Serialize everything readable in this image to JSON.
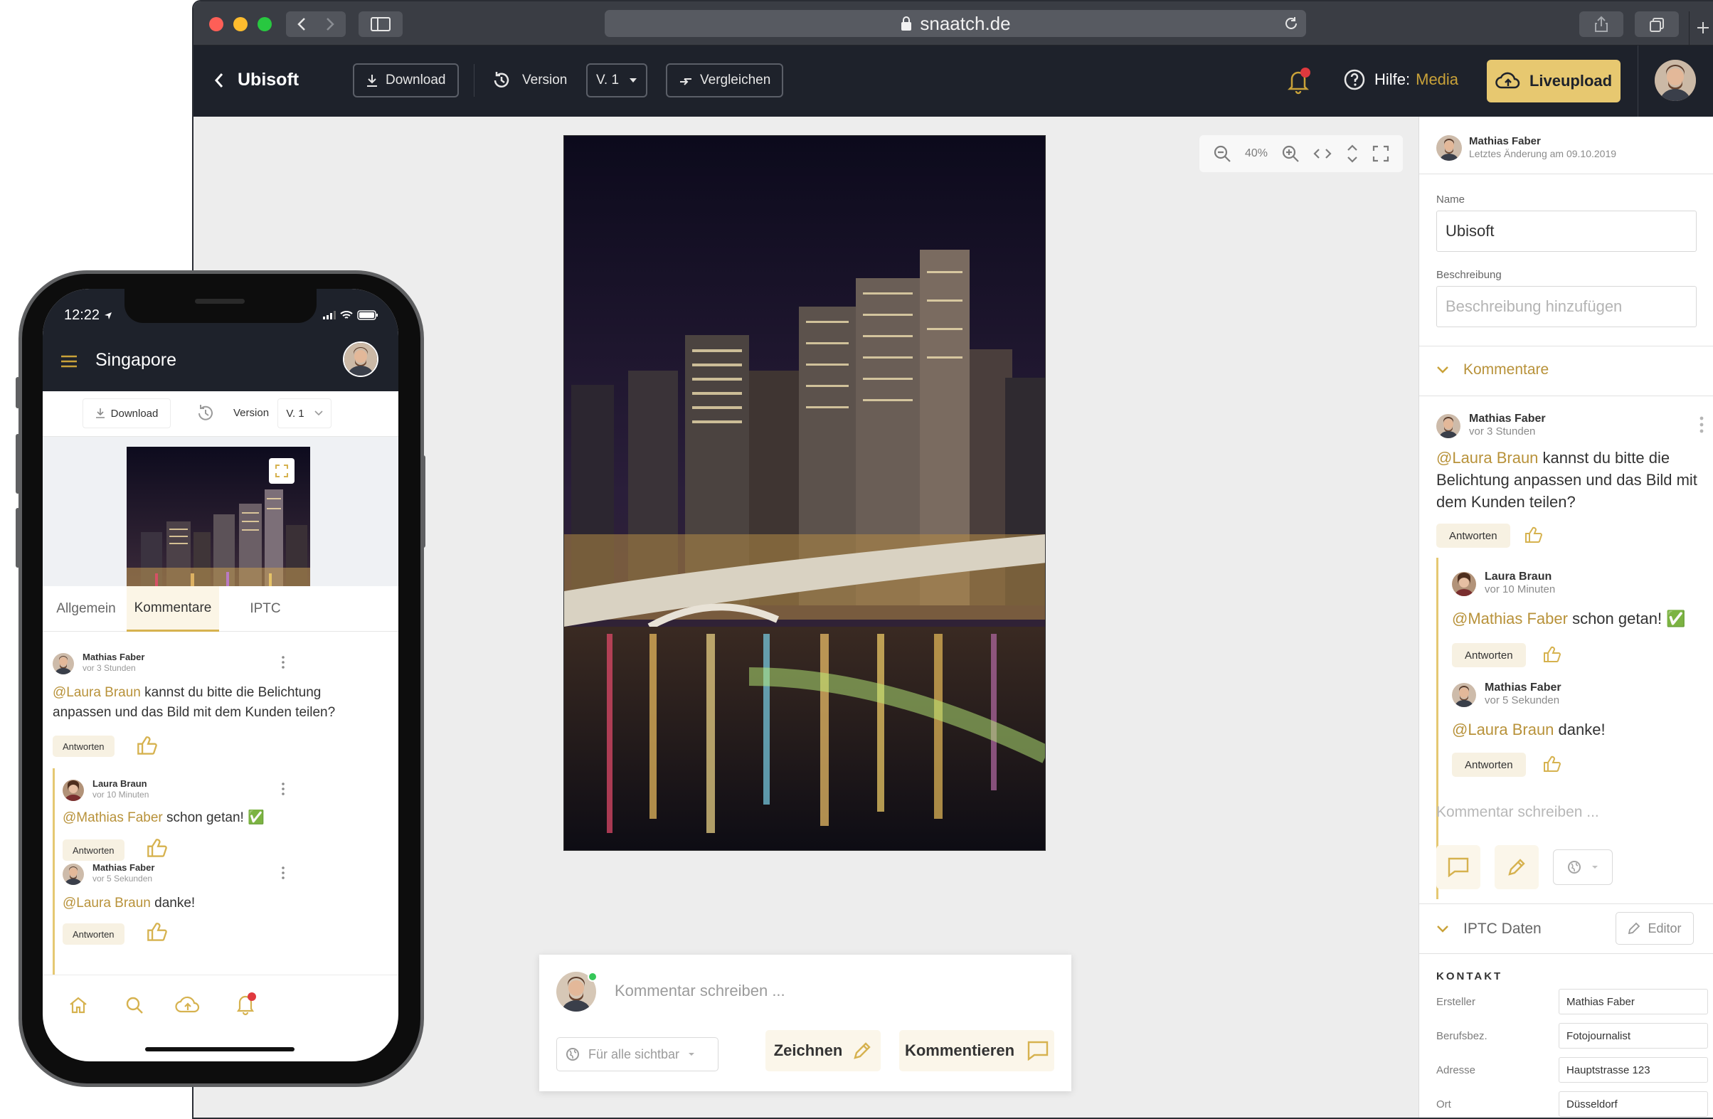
{
  "browser": {
    "url": "snaatch.de",
    "traffic_lights": [
      "#fe5f57",
      "#febc2e",
      "#28c840"
    ]
  },
  "appbar": {
    "back_title": "Ubisoft",
    "download_label": "Download",
    "version_label": "Version",
    "version_value": "V. 1",
    "compare_label": "Vergleichen",
    "help_label": "Hilfe:",
    "help_value": "Media",
    "liveupload_label": "Liveupload"
  },
  "viewer": {
    "zoom_level": "40%"
  },
  "comment_composer": {
    "placeholder": "Kommentar schreiben ...",
    "visibility": "Für alle sichtbar",
    "draw_label": "Zeichnen",
    "comment_label": "Kommentieren"
  },
  "panel": {
    "author": "Mathias Faber",
    "last_change": "Letztes Änderung am 09.10.2019",
    "name_label": "Name",
    "name_value": "Ubisoft",
    "description_label": "Beschreibung",
    "description_placeholder": "Beschreibung hinzufügen",
    "comments_heading": "Kommentare",
    "comments": [
      {
        "user": "Mathias Faber",
        "time": "vor 3 Stunden",
        "mention": "@Laura Braun",
        "text": " kannst du bitte die Belichtung anpassen und das Bild mit dem Kunden teilen?",
        "reply": "Antworten"
      },
      {
        "user": "Laura Braun",
        "time": "vor 10 Minuten",
        "mention": "@Mathias Faber",
        "text": " schon getan! ✅",
        "reply": "Antworten"
      },
      {
        "user": "Mathias Faber",
        "time": "vor 5 Sekunden",
        "mention": "@Laura Braun",
        "text": " danke!",
        "reply": "Antworten"
      }
    ],
    "write_placeholder": "Kommentar schreiben ...",
    "iptc_heading": "IPTC Daten",
    "editor_label": "Editor",
    "kontakt_heading": "KONTAKT",
    "iptc_fields": [
      {
        "label": "Ersteller",
        "value": "Mathias Faber"
      },
      {
        "label": "Berufsbez.",
        "value": "Fotojournalist"
      },
      {
        "label": "Adresse",
        "value": "Hauptstrasse 123"
      },
      {
        "label": "Ort",
        "value": "Düsseldorf"
      }
    ]
  },
  "phone": {
    "time": "12:22",
    "title": "Singapore",
    "download_label": "Download",
    "version_label": "Version",
    "version_value": "V. 1",
    "tabs": [
      "Allgemein",
      "Kommentare",
      "IPTC"
    ],
    "active_tab": "Kommentare",
    "comments": [
      {
        "user": "Mathias Faber",
        "time": "vor 3 Stunden",
        "mention": "@Laura Braun",
        "text": " kannst du bitte die Belichtung anpassen und das Bild mit dem Kunden teilen?",
        "reply": "Antworten"
      },
      {
        "user": "Laura Braun",
        "time": "vor 10 Minuten",
        "mention": "@Mathias Faber",
        "text": " schon getan! ✅",
        "reply": "Antworten"
      },
      {
        "user": "Mathias Faber",
        "time": "vor 5 Sekunden",
        "mention": "@Laura Braun",
        "text": " danke!",
        "reply": "Antworten"
      }
    ]
  },
  "colors": {
    "accent": "#c9a239",
    "accent_button": "#e7c870",
    "dark_header": "#1e222b",
    "notification": "#e0393e"
  }
}
